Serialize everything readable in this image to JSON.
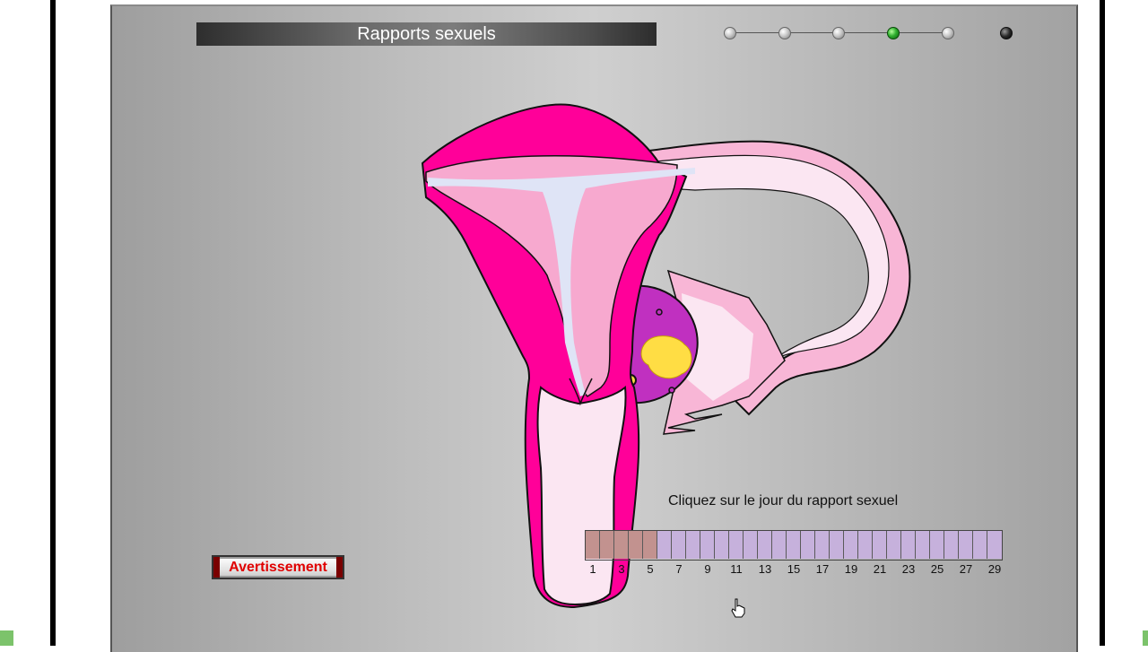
{
  "title": "Rapports sexuels",
  "progress": {
    "steps": 6,
    "active_index": 3
  },
  "instruction": "Cliquez sur le jour du rapport sexuel",
  "calendar": {
    "days": 29,
    "past_days": 5,
    "labels": [
      "1",
      "3",
      "5",
      "7",
      "9",
      "11",
      "13",
      "15",
      "17",
      "19",
      "21",
      "23",
      "25",
      "27",
      "29"
    ]
  },
  "warning_button": "Avertissement",
  "colors": {
    "uterus_wall": "#ff0099",
    "endometrium": "#f7a9cf",
    "tube": "#f8b6d6",
    "ovary": "#c030c0",
    "corpus_luteum": "#ffdd44",
    "past_day": "#c2928f",
    "future_day": "#c6b1dc",
    "active_step": "#2fb02f"
  }
}
